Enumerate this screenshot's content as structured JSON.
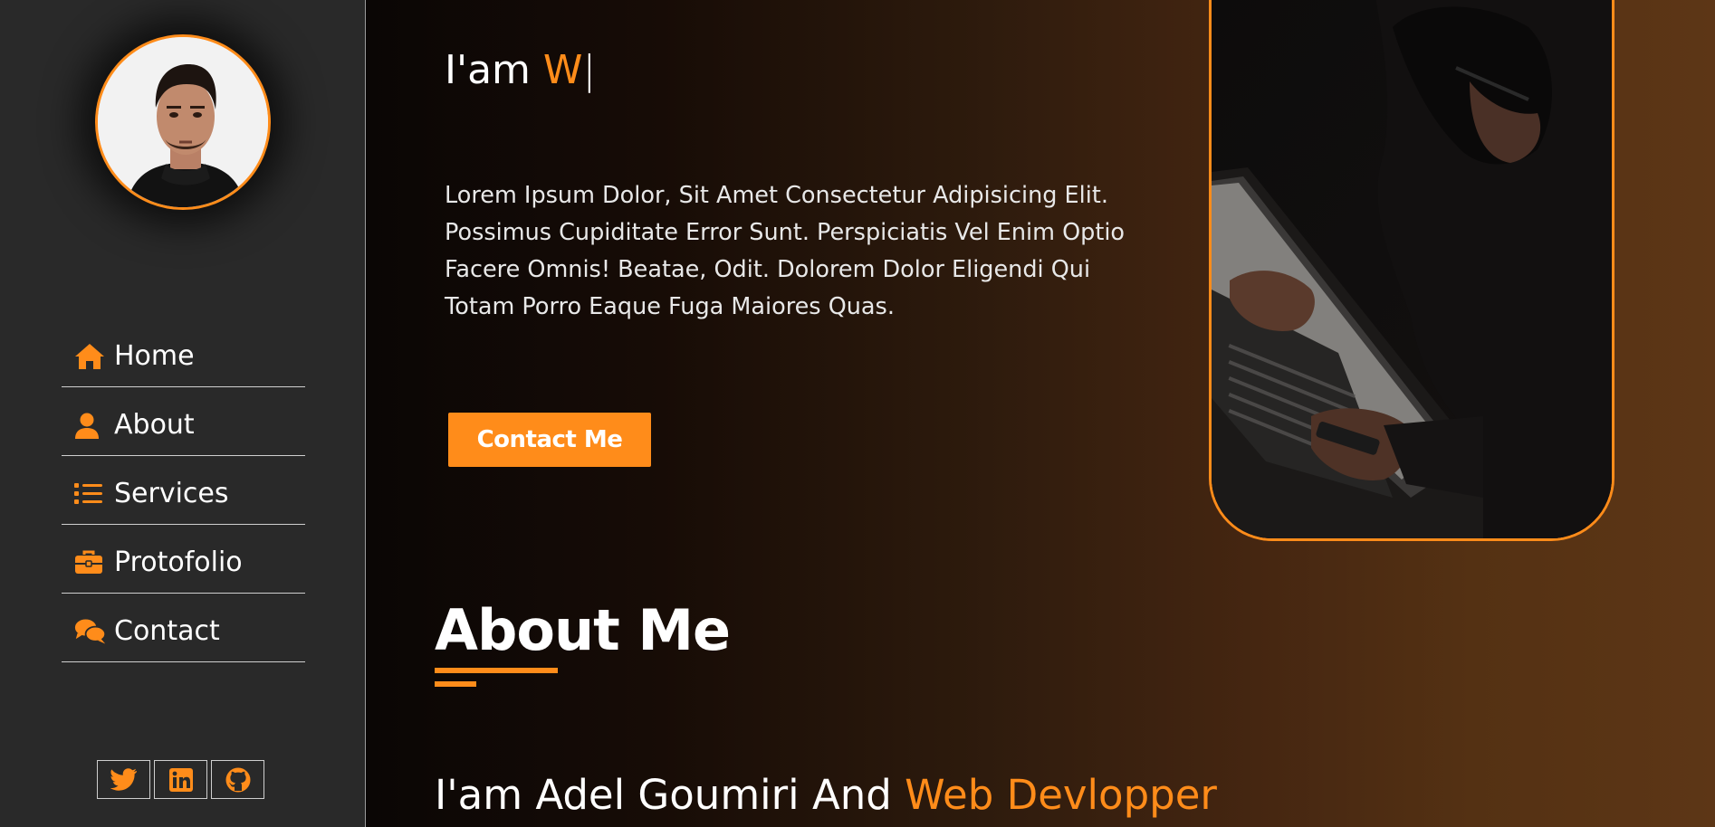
{
  "sidebar": {
    "nav": [
      {
        "label": "Home",
        "icon": "house-icon"
      },
      {
        "label": "About",
        "icon": "user-icon"
      },
      {
        "label": "Services",
        "icon": "list-icon"
      },
      {
        "label": "Protofolio",
        "icon": "briefcase-icon"
      },
      {
        "label": "Contact",
        "icon": "comments-icon"
      }
    ],
    "socials": [
      "twitter-icon",
      "linkedin-icon",
      "github-icon"
    ]
  },
  "hero": {
    "typed_prefix": "I'am ",
    "typed_text": "W",
    "typed_cursor": "|",
    "intro": "Lorem Ipsum Dolor, Sit Amet Consectetur Adipisicing Elit. Possimus Cupiditate Error Sunt. Perspiciatis Vel Enim Optio Facere Omnis! Beatae, Odit. Dolorem Dolor Eligendi Qui Totam Porro Eaque Fuga Maiores Quas.",
    "button_label": "Contact Me"
  },
  "about": {
    "title": "About Me",
    "subheading_prefix": "I'am Adel Goumiri And ",
    "subheading_accent": "Web Devlopper"
  },
  "colors": {
    "accent": "#ff8c1a",
    "sidebar_bg": "#292929",
    "text": "#ffffff"
  }
}
